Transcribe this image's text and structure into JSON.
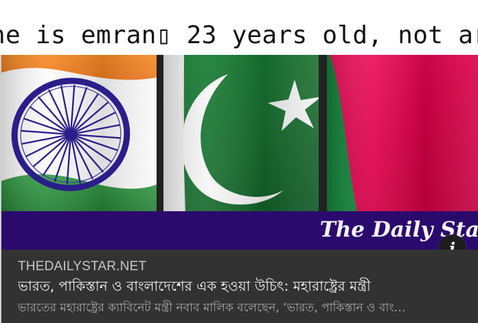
{
  "caption_text": "ne is emran▯ 23 years old, not ar",
  "link_preview": {
    "image": {
      "masthead": "The Daily Star",
      "flags": [
        "india-flag",
        "pakistan-flag",
        "bangladesh-flag"
      ]
    },
    "domain": "THEDAILYSTAR.NET",
    "headline": "ভারত, পাকিস্তান ও বাংলাদেশের এক হওয়া উচিৎ: মহারাষ্ট্রের মন্ত্রী",
    "description": "ভারতের মহারাষ্ট্রের ক্যাবিনেট মন্ত্রী নবাব মালিক বলেছেন, ‘ভারত, পাকিস্তান ও বাং…",
    "info_icon": "info-icon"
  },
  "colors": {
    "card_background": "#323232",
    "purple_band": "#2b0a6d",
    "pakistan_green": "#176a2d",
    "bangladesh_red": "#e0004f",
    "india_saffron": "#f57f22",
    "india_green": "#2d8f3e",
    "chakra_navy": "#2a1f88"
  }
}
